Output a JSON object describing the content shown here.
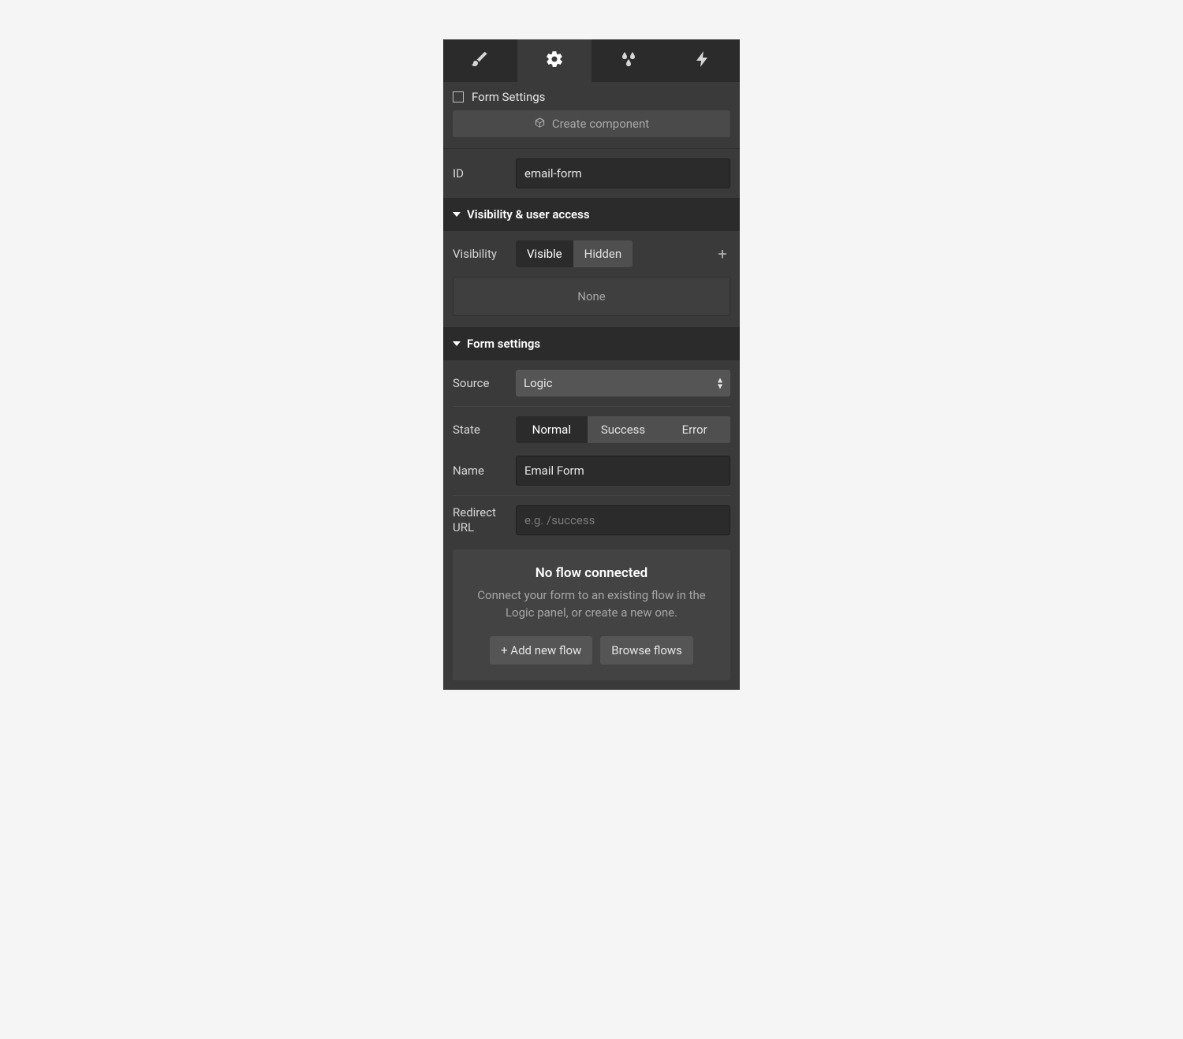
{
  "tabs": {
    "style": "style",
    "settings": "settings",
    "effects": "effects",
    "interactions": "interactions"
  },
  "element": {
    "name": "Form Settings"
  },
  "create_component_label": "Create component",
  "id_row": {
    "label": "ID",
    "value": "email-form"
  },
  "sections": {
    "visibility": {
      "title": "Visibility & user access",
      "visibility_label": "Visibility",
      "options": {
        "visible": "Visible",
        "hidden": "Hidden"
      },
      "none": "None"
    },
    "form": {
      "title": "Form settings",
      "source_label": "Source",
      "source_value": "Logic",
      "state_label": "State",
      "states": {
        "normal": "Normal",
        "success": "Success",
        "error": "Error"
      },
      "name_label": "Name",
      "name_value": "Email Form",
      "redirect_label_line1": "Redirect",
      "redirect_label_line2": "URL",
      "redirect_placeholder": "e.g. /success",
      "flow": {
        "title": "No flow connected",
        "desc": "Connect your form to an existing flow in the Logic panel, or create a new one.",
        "add_label": "+ Add new flow",
        "browse_label": "Browse flows"
      }
    }
  }
}
